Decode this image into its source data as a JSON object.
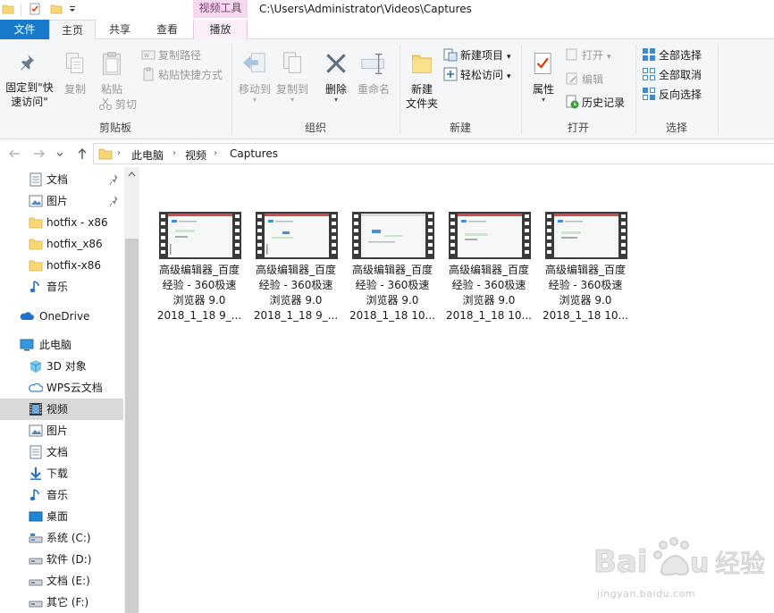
{
  "titlebar": {
    "context_tab_title": "视频工具",
    "path": "C:\\Users\\Administrator\\Videos\\Captures"
  },
  "tabs": {
    "file": "文件",
    "home": "主页",
    "share": "共享",
    "view": "查看",
    "play": "播放"
  },
  "ribbon": {
    "clipboard": {
      "label": "剪贴板",
      "pin_quick_line1": "固定到\"快",
      "pin_quick_line2": "速访问\"",
      "copy": "复制",
      "paste": "粘贴",
      "copy_path": "复制路径",
      "paste_shortcut": "粘贴快捷方式",
      "cut": "剪切"
    },
    "organize": {
      "label": "组织",
      "move_to": "移动到",
      "copy_to": "复制到",
      "delete": "删除",
      "rename": "重命名"
    },
    "new": {
      "label": "新建",
      "new_folder_line1": "新建",
      "new_folder_line2": "文件夹",
      "new_item": "新建项目",
      "easy_access": "轻松访问"
    },
    "open": {
      "label": "打开",
      "properties": "属性",
      "open": "打开",
      "edit": "编辑",
      "history": "历史记录"
    },
    "select": {
      "label": "选择",
      "select_all": "全部选择",
      "select_none": "全部取消",
      "invert": "反向选择"
    }
  },
  "address": {
    "crumbs": [
      "此电脑",
      "视频",
      "Captures"
    ]
  },
  "nav": {
    "items": [
      {
        "label": "文档",
        "icon": "document-icon",
        "pinned": true
      },
      {
        "label": "图片",
        "icon": "picture-icon",
        "pinned": true
      },
      {
        "label": "hotfix - x86",
        "icon": "folder-icon"
      },
      {
        "label": "hotfix_x86",
        "icon": "folder-icon"
      },
      {
        "label": "hotfix-x86",
        "icon": "folder-icon"
      },
      {
        "label": "音乐",
        "icon": "music-icon"
      },
      {
        "label": "OneDrive",
        "icon": "cloud-icon"
      },
      {
        "label": "此电脑",
        "icon": "computer-icon"
      },
      {
        "label": "3D 对象",
        "icon": "cube-icon"
      },
      {
        "label": "WPS云文档",
        "icon": "wps-cloud-icon"
      },
      {
        "label": "视频",
        "icon": "video-icon",
        "selected": true
      },
      {
        "label": "图片",
        "icon": "picture-icon"
      },
      {
        "label": "文档",
        "icon": "document-icon"
      },
      {
        "label": "下载",
        "icon": "download-icon"
      },
      {
        "label": "音乐",
        "icon": "music-icon"
      },
      {
        "label": "桌面",
        "icon": "desktop-icon"
      },
      {
        "label": "系统 (C:)",
        "icon": "drive-icon"
      },
      {
        "label": "软件 (D:)",
        "icon": "drive-icon"
      },
      {
        "label": "文档 (E:)",
        "icon": "drive-icon"
      },
      {
        "label": "其它 (F:)",
        "icon": "drive-icon"
      }
    ]
  },
  "files": [
    {
      "name": "高级编辑器_百度\n经验 - 360极速\n浏览器 9.0\n2018_1_18 9_..."
    },
    {
      "name": "高级编辑器_百度\n经验 - 360极速\n浏览器 9.0\n2018_1_18 9_..."
    },
    {
      "name": "高级编辑器_百度\n经验 - 360极速\n浏览器 9.0\n2018_1_18 10..."
    },
    {
      "name": "高级编辑器_百度\n经验 - 360极速\n浏览器 9.0\n2018_1_18 10..."
    },
    {
      "name": "高级编辑器_百度\n经验 - 360极速\n浏览器 9.0\n2018_1_18 10..."
    }
  ],
  "watermark": {
    "url": "jingyan.baidu.com"
  },
  "colors": {
    "file_tab": "#1979ca",
    "context_tab": "#f6d8ef",
    "selection": "#d9d9d9"
  }
}
